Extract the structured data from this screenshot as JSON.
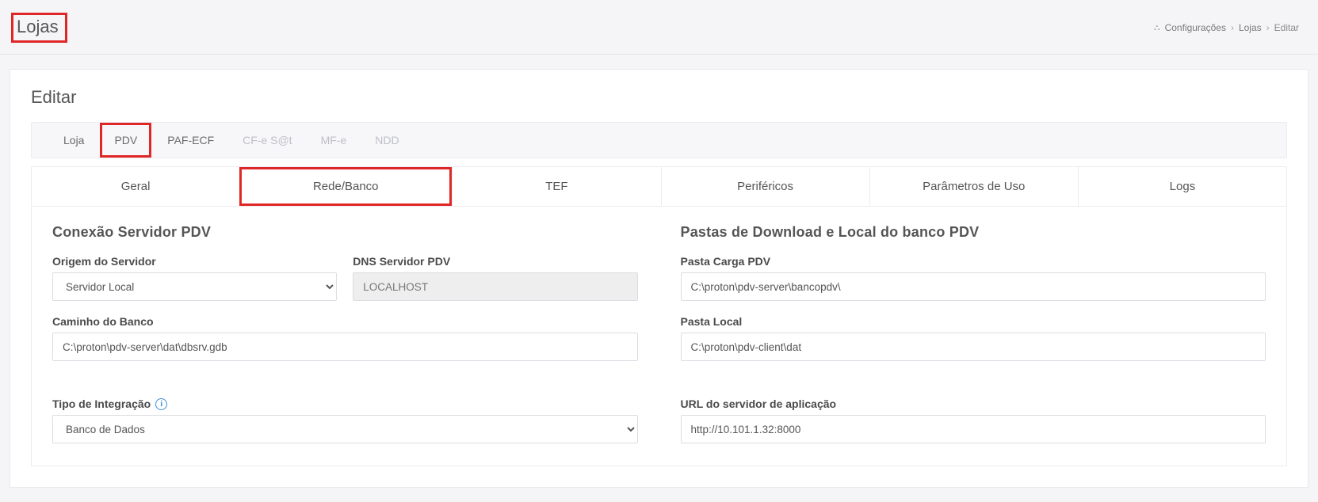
{
  "header": {
    "title": "Lojas",
    "breadcrumb": {
      "root": "Configurações",
      "mid": "Lojas",
      "leaf": "Editar"
    }
  },
  "card": {
    "title": "Editar"
  },
  "tabs1": {
    "loja": "Loja",
    "pdv": "PDV",
    "pafecf": "PAF-ECF",
    "cfesat": "CF-e S@t",
    "mfe": "MF-e",
    "ndd": "NDD"
  },
  "tabs2": {
    "geral": "Geral",
    "rede": "Rede/Banco",
    "tef": "TEF",
    "perif": "Periféricos",
    "param": "Parâmetros de Uso",
    "logs": "Logs"
  },
  "left": {
    "section": "Conexão Servidor PDV",
    "origem_label": "Origem do Servidor",
    "origem_value": "Servidor Local",
    "dns_label": "DNS Servidor PDV",
    "dns_value": "LOCALHOST",
    "caminho_label": "Caminho do Banco",
    "caminho_value": "C:\\proton\\pdv-server\\dat\\dbsrv.gdb",
    "tipo_label": "Tipo de Integração",
    "tipo_value": "Banco de Dados"
  },
  "right": {
    "section": "Pastas de Download e Local do banco PDV",
    "carga_label": "Pasta Carga PDV",
    "carga_value": "C:\\proton\\pdv-server\\bancopdv\\",
    "local_label": "Pasta Local",
    "local_value": "C:\\proton\\pdv-client\\dat",
    "url_label": "URL do servidor de aplicação",
    "url_value": "http://10.101.1.32:8000"
  }
}
